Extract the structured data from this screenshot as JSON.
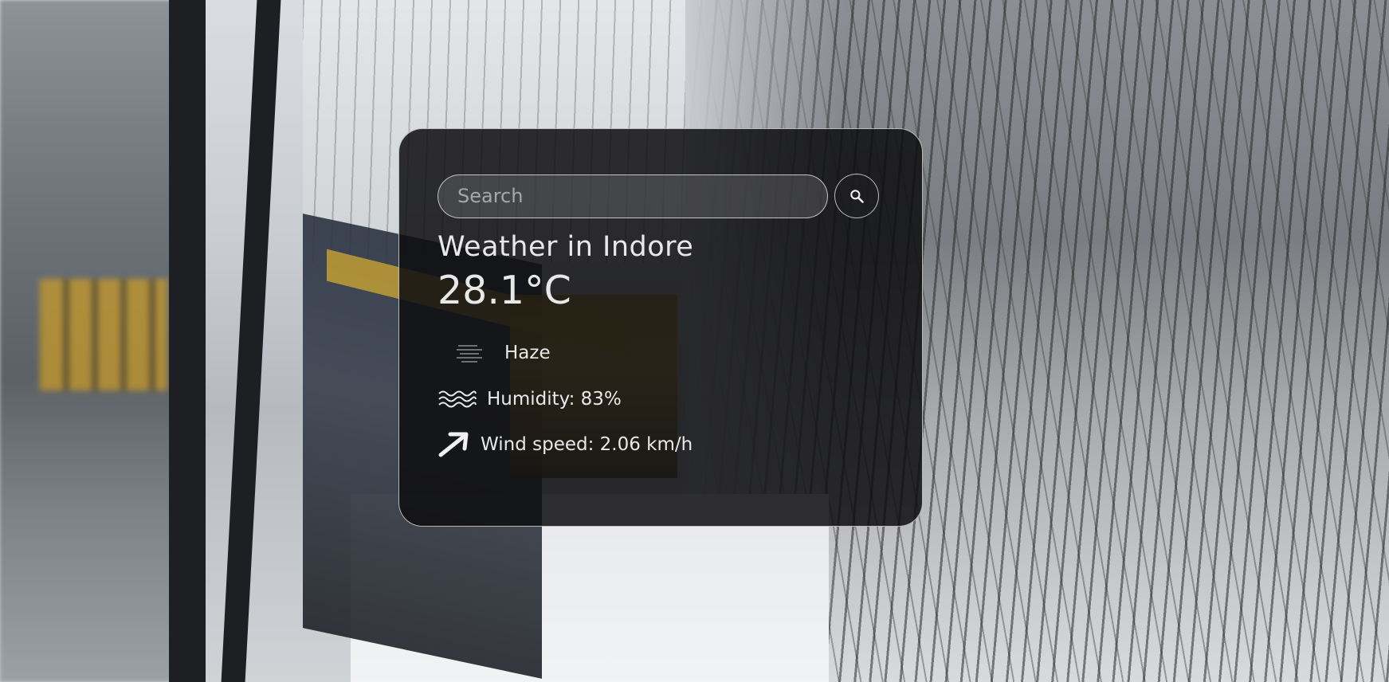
{
  "search": {
    "placeholder": "Search",
    "value": ""
  },
  "weather": {
    "title": "Weather in Indore",
    "temperature": "28.1°C",
    "description": "Haze",
    "humidity": "Humidity: 83%",
    "wind": "Wind speed: 2.06 km/h"
  },
  "icons": {
    "search": "search-icon",
    "description": "haze-icon",
    "humidity": "humidity-waves-icon",
    "wind": "wind-arrow-icon"
  },
  "colors": {
    "card_background": "#0e0e10",
    "card_border": "#ebebeb",
    "text": "#e8e8e8"
  }
}
